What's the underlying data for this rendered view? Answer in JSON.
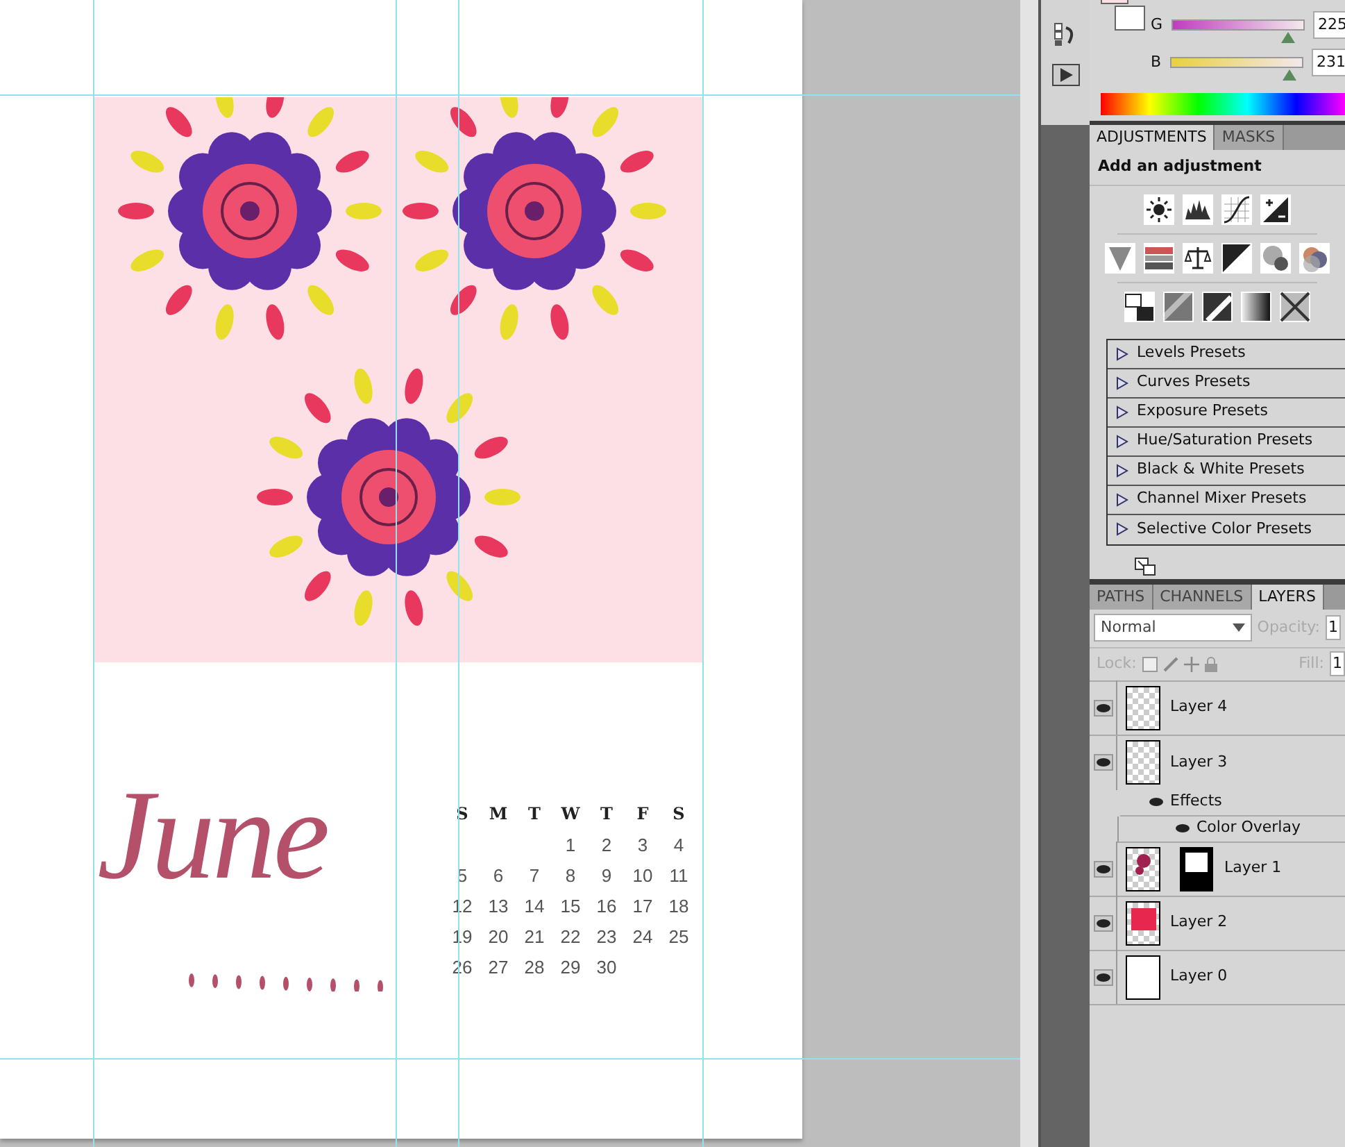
{
  "document": {
    "month": "June",
    "calendar": {
      "weekdays": [
        "S",
        "M",
        "T",
        "W",
        "T",
        "F",
        "S"
      ],
      "weeks": [
        {
          "kind": "end",
          "days": [
            "1",
            "2",
            "3",
            "4"
          ]
        },
        {
          "kind": "full",
          "days": [
            "5",
            "6",
            "7",
            "8",
            "9",
            "10",
            "11"
          ]
        },
        {
          "kind": "full",
          "days": [
            "12",
            "13",
            "14",
            "15",
            "16",
            "17",
            "18"
          ]
        },
        {
          "kind": "full",
          "days": [
            "19",
            "20",
            "21",
            "22",
            "23",
            "24",
            "25"
          ]
        },
        {
          "kind": "start",
          "days": [
            "26",
            "27",
            "28",
            "29",
            "30"
          ]
        }
      ]
    }
  },
  "color_panel": {
    "channels": [
      {
        "label": "G",
        "value": "225",
        "level": 0.89
      },
      {
        "label": "B",
        "value": "231",
        "level": 0.91
      }
    ]
  },
  "adjustments_panel": {
    "tabs": [
      {
        "label": "ADJUSTMENTS",
        "selected": true
      },
      {
        "label": "MASKS",
        "selected": false
      }
    ],
    "heading": "Add an adjustment",
    "presets": [
      {
        "label": "Levels Presets",
        "expanded": false
      },
      {
        "label": "Curves Presets",
        "expanded": false
      },
      {
        "label": "Exposure Presets",
        "expanded": false
      },
      {
        "label": "Hue/Saturation Presets",
        "expanded": false
      },
      {
        "label": "Black & White Presets",
        "expanded": false
      },
      {
        "label": "Channel Mixer Presets",
        "expanded": false
      },
      {
        "label": "Selective Color Presets",
        "expanded": false
      }
    ]
  },
  "layers_panel": {
    "tabs": [
      {
        "label": "PATHS",
        "selected": false
      },
      {
        "label": "CHANNELS",
        "selected": false
      },
      {
        "label": "LAYERS",
        "selected": true
      }
    ],
    "blend_mode": "Normal",
    "opacity_label": "Opacity:",
    "opacity_value": "1",
    "lock_label": "Lock:",
    "fill_label": "Fill:",
    "fill_value": "1",
    "layers": [
      {
        "name": "Layer 4",
        "visible": true,
        "kind": "transparent",
        "mask": false
      },
      {
        "name": "Layer 3",
        "visible": true,
        "kind": "transparent",
        "mask": false,
        "effects": {
          "label": "Effects",
          "visible": true,
          "children": [
            {
              "label": "Color Overlay",
              "visible": true
            }
          ]
        }
      },
      {
        "name": "Layer 1",
        "visible": true,
        "kind": "art",
        "mask": true
      },
      {
        "name": "Layer 2",
        "visible": true,
        "kind": "fill",
        "mask": false
      },
      {
        "name": "Layer 0",
        "visible": true,
        "kind": "white",
        "mask": false
      }
    ]
  }
}
